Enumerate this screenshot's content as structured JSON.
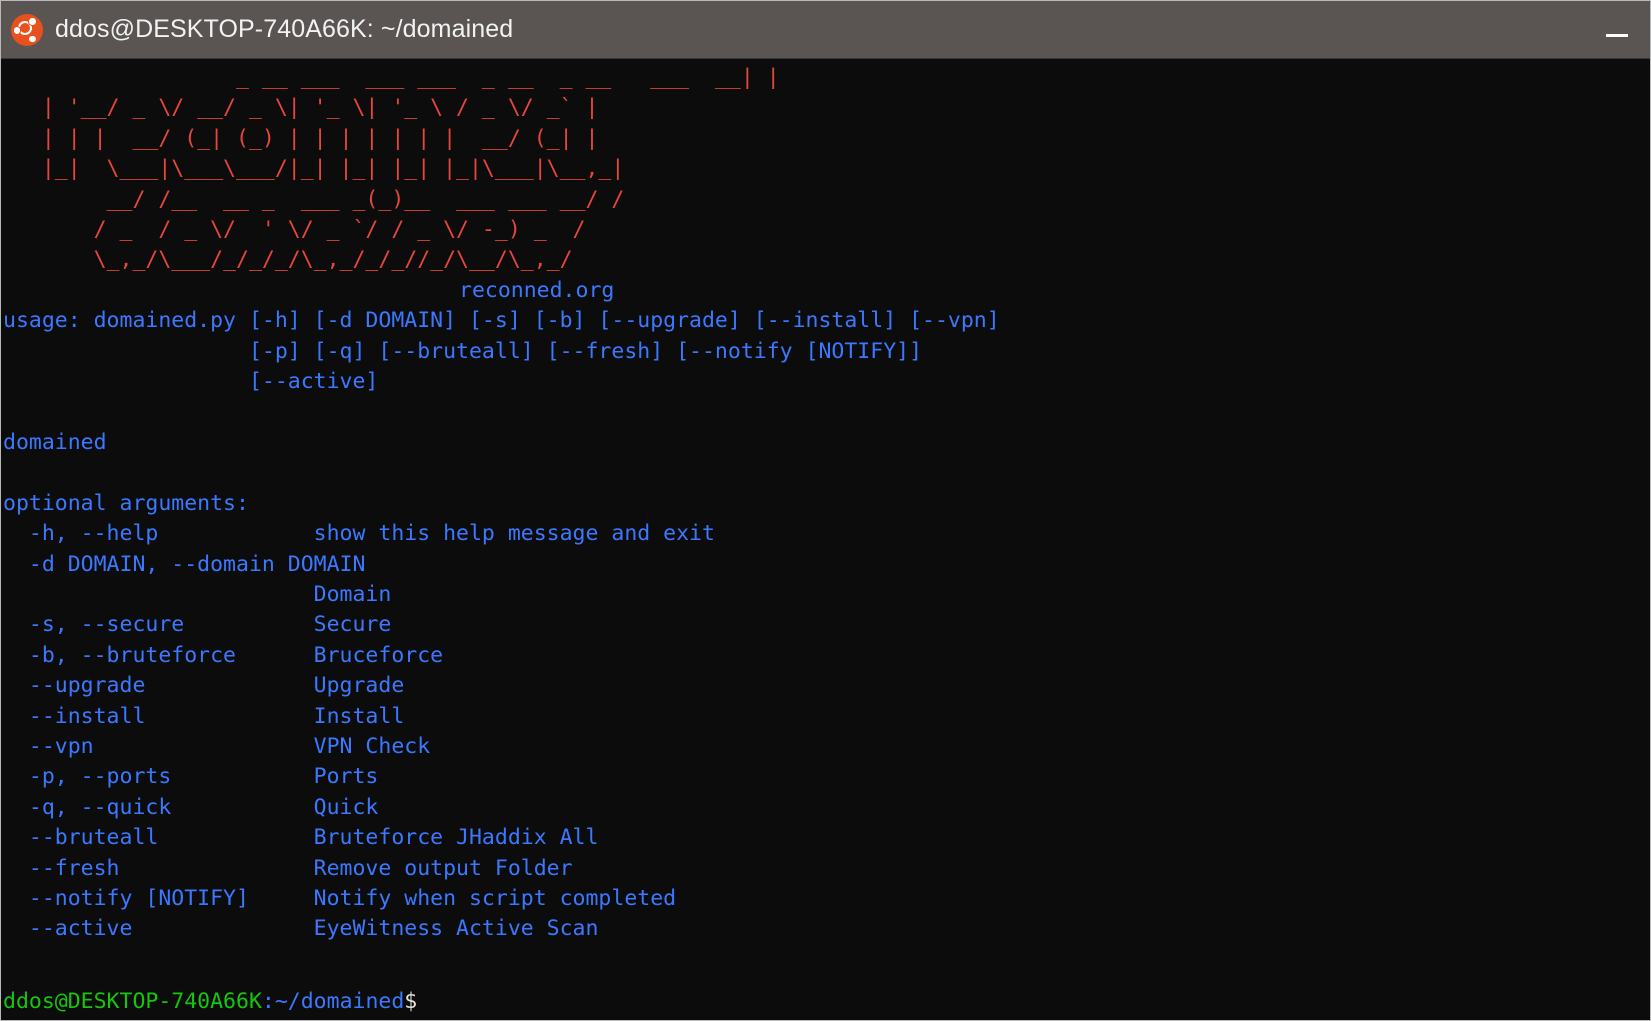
{
  "window": {
    "title": "ddos@DESKTOP-740A66K: ~/domained",
    "icon": "ubuntu-logo-icon",
    "titlebar_bg": "#5a5553",
    "terminal_bg": "#0c0c0c",
    "controls": {
      "minimize_label": "—"
    }
  },
  "colors": {
    "ascii_red": "#e8453c",
    "text_blue": "#3b78ff",
    "prompt_green": "#16c60c",
    "prompt_white": "#e6e4de"
  },
  "banner": {
    "ascii_art": [
      "                  _ __ ___  ___ ___  _ __  _ __   ___  __| |",
      "   | '__/ _ \\/ __/ _ \\| '_ \\| '_ \\ / _ \\/ _` |",
      "   | | |  __/ (_| (_) | | | | | | |  __/ (_| |",
      "   |_|  \\___|\\___\\___/|_| |_| |_| |_|\\___|\\__,_|",
      "        __/ /__  __ _  ___ _(_)__  ___ ___ __/ /",
      "       / _  / _ \\/  ' \\/ _ `/ / _ \\/ -_) _  /",
      "       \\_,_/\\___/_/_/_/\\_,_/_/_//_/\\__/\\_,_/"
    ],
    "site": "reconned.org"
  },
  "usage": {
    "lines": [
      "usage: domained.py [-h] [-d DOMAIN] [-s] [-b] [--upgrade] [--install] [--vpn]",
      "                   [-p] [-q] [--bruteall] [--fresh] [--notify [NOTIFY]]",
      "                   [--active]"
    ]
  },
  "program_name": "domained",
  "arguments_section": {
    "heading": "optional arguments:",
    "items": [
      {
        "flag": "  -h, --help",
        "help": "show this help message and exit"
      },
      {
        "flag": "  -d DOMAIN, --domain DOMAIN",
        "help": ""
      },
      {
        "flag": "",
        "help": "Domain"
      },
      {
        "flag": "  -s, --secure",
        "help": "Secure"
      },
      {
        "flag": "  -b, --bruteforce",
        "help": "Bruceforce"
      },
      {
        "flag": "  --upgrade",
        "help": "Upgrade"
      },
      {
        "flag": "  --install",
        "help": "Install"
      },
      {
        "flag": "  --vpn",
        "help": "VPN Check"
      },
      {
        "flag": "  -p, --ports",
        "help": "Ports"
      },
      {
        "flag": "  -q, --quick",
        "help": "Quick"
      },
      {
        "flag": "  --bruteall",
        "help": "Bruteforce JHaddix All"
      },
      {
        "flag": "  --fresh",
        "help": "Remove output Folder"
      },
      {
        "flag": "  --notify [NOTIFY]",
        "help": "Notify when script completed"
      },
      {
        "flag": "  --active",
        "help": "EyeWitness Active Scan"
      }
    ],
    "rendered_lines": [
      "  -h, --help            show this help message and exit",
      "  -d DOMAIN, --domain DOMAIN",
      "                        Domain",
      "  -s, --secure          Secure",
      "  -b, --bruteforce      Bruceforce",
      "  --upgrade             Upgrade",
      "  --install             Install",
      "  --vpn                 VPN Check",
      "  -p, --ports           Ports",
      "  -q, --quick           Quick",
      "  --bruteall            Bruteforce JHaddix All",
      "  --fresh               Remove output Folder",
      "  --notify [NOTIFY]     Notify when script completed",
      "  --active              EyeWitness Active Scan"
    ]
  },
  "prompt": {
    "user_host": "ddos@DESKTOP-740A66K",
    "separator": ":",
    "path": "~/domained",
    "sigil": "$",
    "command": ""
  }
}
